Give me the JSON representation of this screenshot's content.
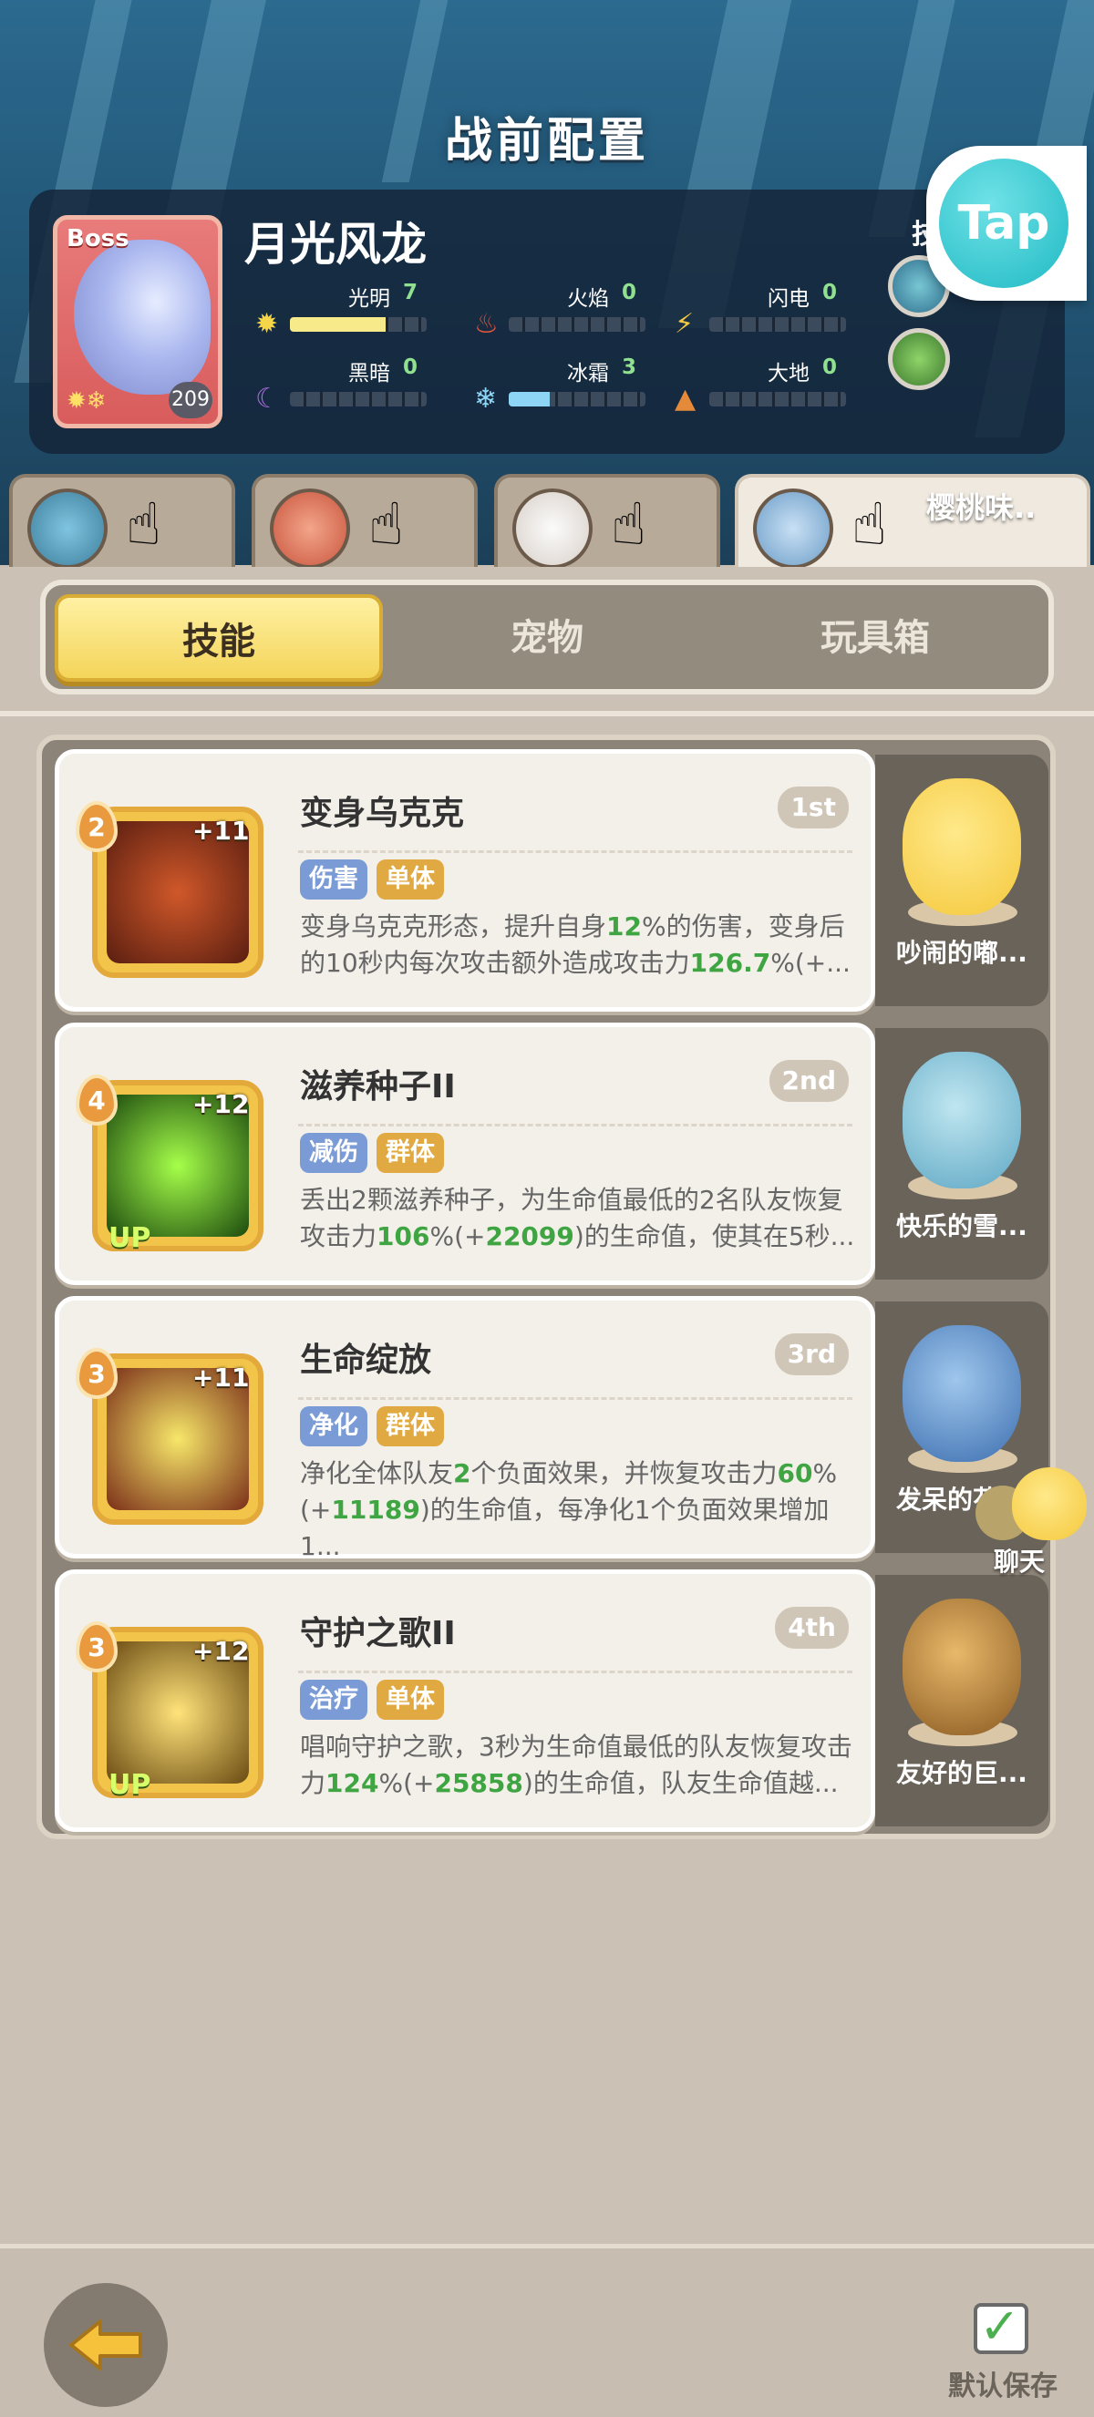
{
  "header": {
    "title": "战前配置",
    "tap_label": "Tap",
    "skill_label": "技能"
  },
  "boss": {
    "tag": "Boss",
    "name": "月光风龙",
    "level": "209",
    "elements": [
      {
        "label": "光明",
        "value": "7",
        "fill": 0.7,
        "color": "#f5e27a"
      },
      {
        "label": "火焰",
        "value": "0",
        "fill": 0,
        "color": "#e96a4a"
      },
      {
        "label": "闪电",
        "value": "0",
        "fill": 0,
        "color": "#f5c842"
      },
      {
        "label": "黑暗",
        "value": "0",
        "fill": 0,
        "color": "#9a5fd0"
      },
      {
        "label": "冰霜",
        "value": "3",
        "fill": 0.3,
        "color": "#8ed5f5"
      },
      {
        "label": "大地",
        "value": "0",
        "fill": 0,
        "color": "#e5893a"
      }
    ]
  },
  "team": [
    {
      "name": ""
    },
    {
      "name": ""
    },
    {
      "name": ""
    },
    {
      "name": "樱桃味.."
    }
  ],
  "tabs": [
    {
      "label": "技能"
    },
    {
      "label": "宠物"
    },
    {
      "label": "玩具箱"
    }
  ],
  "skills": [
    {
      "name": "变身乌克克",
      "rank": "1st",
      "level": "2",
      "plus": "+11",
      "up": "",
      "tags": [
        "伤害",
        "单体"
      ],
      "desc_parts": [
        "变身乌克克形态，提升自身",
        "12",
        "%的伤害，变身后的10秒内每次攻击额外造成攻击力",
        "126.7",
        "%(+..."
      ],
      "pet": "吵闹的嘟..."
    },
    {
      "name": "滋养种子II",
      "rank": "2nd",
      "level": "4",
      "plus": "+12",
      "up": "UP",
      "tags": [
        "减伤",
        "群体"
      ],
      "desc_parts": [
        "丢出2颗滋养种子，为生命值最低的2名队友恢复攻击力",
        "106",
        "%(+",
        "22099",
        ")的生命值，使其在5秒..."
      ],
      "pet": "快乐的雪..."
    },
    {
      "name": "生命绽放",
      "rank": "3rd",
      "level": "3",
      "plus": "+11",
      "up": "",
      "tags": [
        "净化",
        "群体"
      ],
      "desc_parts": [
        "净化全体队友",
        "2",
        "个负面效果，并恢复攻击力",
        "60",
        "%(+",
        "11189",
        ")的生命值，每净化1个负面效果增加1..."
      ],
      "pet": "发呆的花..."
    },
    {
      "name": "守护之歌II",
      "rank": "4th",
      "level": "3",
      "plus": "+12",
      "up": "UP",
      "tags": [
        "治疗",
        "单体"
      ],
      "desc_parts": [
        "唱响守护之歌，3秒为生命值最低的队友恢复攻击力",
        "124",
        "%(+",
        "25858",
        ")的生命值，队友生命值越..."
      ],
      "pet": "友好的巨..."
    }
  ],
  "chat": {
    "label": "聊天"
  },
  "footer": {
    "save_label": "默认保存"
  }
}
